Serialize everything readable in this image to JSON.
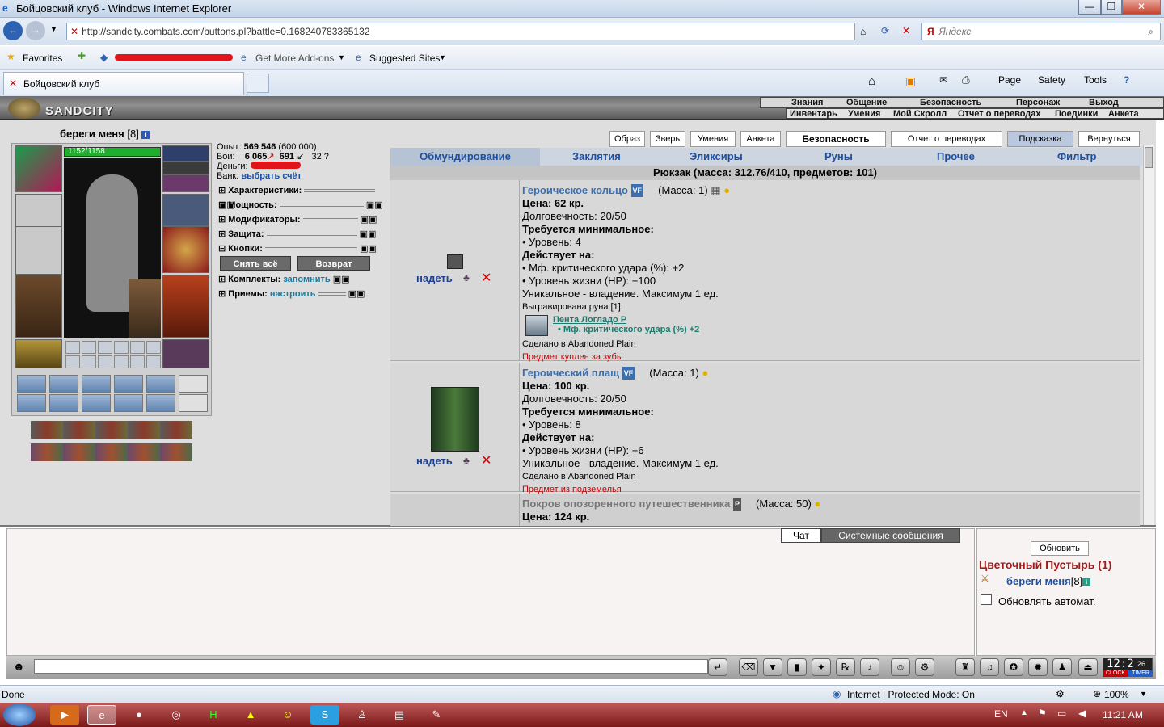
{
  "browser": {
    "window_title": "Бойцовский клуб - Windows Internet Explorer",
    "url": "http://sandcity.combats.com/buttons.pl?battle=0.168240783365132",
    "search_placeholder": "Яндекс",
    "favorites_label": "Favorites",
    "addons_label": "Get More Add-ons",
    "suggested_label": "Suggested Sites",
    "tab_title": "Бойцовский клуб",
    "commands": [
      "Page",
      "Safety",
      "Tools"
    ],
    "status_left": "Done",
    "status_zone": "Internet | Protected Mode: On",
    "zoom": "100%"
  },
  "game": {
    "logo": "SANDCITY",
    "nav_top": [
      "Знания",
      "Общение",
      "Безопасность",
      "Персонаж",
      "Выход"
    ],
    "nav_bottom": [
      "Инвентарь",
      "Умения",
      "Мой Скролл",
      "Отчет о переводах",
      "Поединки",
      "Анкета"
    ],
    "character": {
      "name": "береги меня",
      "level": "[8]",
      "hp": "1152/1158"
    },
    "stats": {
      "exp_label": "Опыт:",
      "exp_value": "569 546",
      "exp_next": "(600 000)",
      "fights_label": "Бои:",
      "wins": "6 065",
      "losses": "691",
      "draws": "32",
      "money_label": "Деньги:",
      "bank_label": "Банк:",
      "bank_link": "выбрать счёт"
    },
    "sections": [
      "Характеристики:",
      "Мощность:",
      "Модификаторы:",
      "Защита:",
      "Кнопки:"
    ],
    "buttons": {
      "remove_all": "Снять всё",
      "return": "Возврат"
    },
    "sets_label": "Комплекты:",
    "sets_link": "запомнить",
    "moves_label": "Приемы:",
    "moves_link": "настроить",
    "top_buttons": [
      "Образ",
      "Зверь",
      "Умения",
      "Анкета",
      "Безопасность",
      "Отчет о переводах",
      "Подсказка",
      "Вернуться"
    ],
    "inv_tabs": [
      "Обмундирование",
      "Заклятия",
      "Эликсиры",
      "Руны",
      "Прочее",
      "Фильтр"
    ],
    "backpack": "Рюкзак (масса: 312.76/410, предметов: 101)",
    "wear_label": "надеть",
    "items": [
      {
        "name": "Героическое кольцо",
        "badge": "VF",
        "mass": "(Масса: 1)",
        "price": "Цена: 62 кр.",
        "durability": "Долговечность: 20/50",
        "req_title": "Требуется минимальное:",
        "req": "• Уровень: 4",
        "acts_title": "Действует на:",
        "acts": [
          "• Мф. критического удара (%): +2",
          "• Уровень жизни (HP): +100"
        ],
        "unique": "Уникальное - владение. Максимум 1 ед.",
        "rune_title": "Выгравирована руна [1]:",
        "rune_name": "Пента Логладо Р",
        "rune_effect": "• Мф. критического удара (%) +2",
        "made": "Сделано в Abandoned Plain",
        "note": "Предмет куплен за зубы"
      },
      {
        "name": "Героический плащ",
        "badge": "VF",
        "mass": "(Масса: 1)",
        "price": "Цена: 100 кр.",
        "durability": "Долговечность: 20/50",
        "req_title": "Требуется минимальное:",
        "req": "• Уровень: 8",
        "acts_title": "Действует на:",
        "acts": [
          "• Уровень жизни (HP): +6"
        ],
        "unique": "Уникальное - владение. Максимум 1 ед.",
        "made": "Сделано в Abandoned Plain",
        "note": "Предмет из подземелья"
      },
      {
        "name": "Покров опозоренного путешественника",
        "badge": "P",
        "mass": "(Масса: 50)",
        "price": "Цена: 124 кр."
      }
    ],
    "chat_tabs": [
      "Чат",
      "Системные сообщения"
    ],
    "refresh_btn": "Обновить",
    "location": "Цветочный Пустырь (1)",
    "online_name": "береги меня",
    "online_level": "[8]",
    "auto_refresh": "Обновлять автомат.",
    "clock": "12:2",
    "clock_sec": "26",
    "clock_label": "CLOCK",
    "timer_label": "TIMER"
  },
  "taskbar": {
    "lang": "EN",
    "time": "11:21 AM"
  }
}
